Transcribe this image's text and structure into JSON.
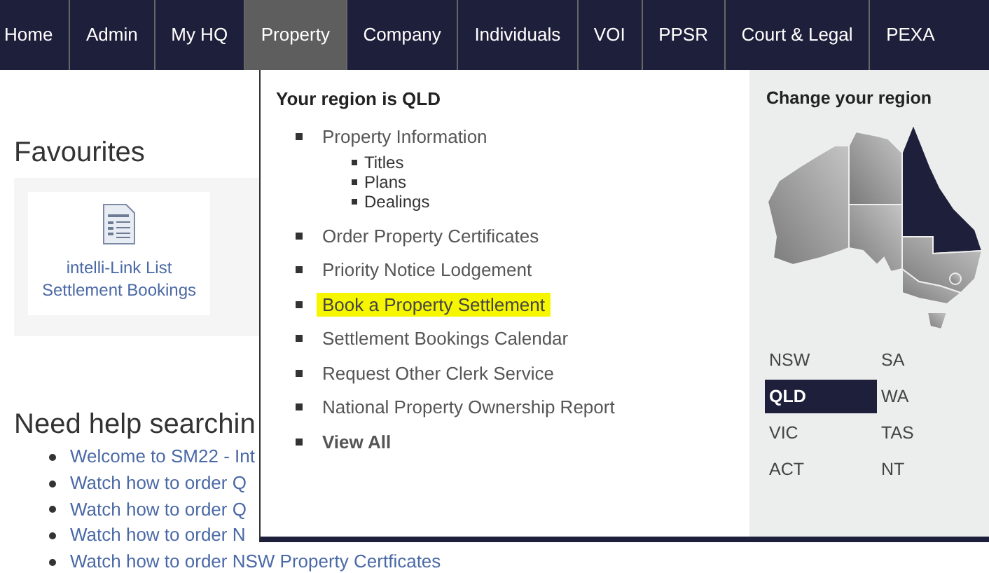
{
  "nav": [
    {
      "label": "Home",
      "selected": false
    },
    {
      "label": "Admin",
      "selected": false
    },
    {
      "label": "My HQ",
      "selected": false
    },
    {
      "label": "Property",
      "selected": true
    },
    {
      "label": "Company",
      "selected": false
    },
    {
      "label": "Individuals",
      "selected": false
    },
    {
      "label": "VOI",
      "selected": false
    },
    {
      "label": "PPSR",
      "selected": false
    },
    {
      "label": "Court & Legal",
      "selected": false
    },
    {
      "label": "PEXA",
      "selected": false
    }
  ],
  "page": {
    "favourites_title": "Favourites",
    "favourites": [
      {
        "label": "intelli-Link List Settlement Bookings"
      }
    ],
    "help_title": "Need help searchin",
    "help_links": [
      "Welcome to SM22 - Int",
      "Watch how to order Q",
      "Watch how to order Q",
      "Watch how to order N",
      "Watch how to order NSW Property Certficates"
    ]
  },
  "dropdown": {
    "heading": "Your region is QLD",
    "items": [
      {
        "label": "Property Information",
        "kind": "link",
        "highlighted": false,
        "children": [
          {
            "label": "Titles"
          },
          {
            "label": "Plans"
          },
          {
            "label": "Dealings"
          }
        ]
      },
      {
        "label": "Order Property Certificates",
        "kind": "link",
        "highlighted": false
      },
      {
        "label": "Priority Notice Lodgement",
        "kind": "link",
        "highlighted": false
      },
      {
        "label": "Book a Property Settlement",
        "kind": "link",
        "highlighted": true
      },
      {
        "label": "Settlement Bookings Calendar",
        "kind": "link",
        "highlighted": false
      },
      {
        "label": "Request Other Clerk Service",
        "kind": "link",
        "highlighted": false
      },
      {
        "label": "National Property Ownership Report",
        "kind": "link",
        "highlighted": false
      },
      {
        "label": "View All",
        "kind": "view_all",
        "highlighted": false
      }
    ],
    "region_title": "Change your region",
    "regions": [
      {
        "label": "NSW",
        "selected": false
      },
      {
        "label": "SA",
        "selected": false
      },
      {
        "label": "QLD",
        "selected": true
      },
      {
        "label": "WA",
        "selected": false
      },
      {
        "label": "VIC",
        "selected": false
      },
      {
        "label": "TAS",
        "selected": false
      },
      {
        "label": "ACT",
        "selected": false
      },
      {
        "label": "NT",
        "selected": false
      }
    ]
  }
}
